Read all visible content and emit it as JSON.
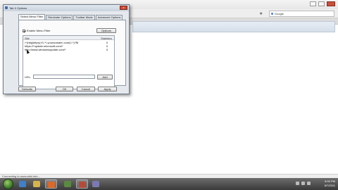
{
  "browser": {
    "search_engine": "Google",
    "status_text": "Connecting to www.abhi.info..."
  },
  "dialog": {
    "title": "Tab X Options",
    "close_label": "x",
    "tabs": [
      {
        "label": "Select Menu Filter"
      },
      {
        "label": "Reminder Options"
      },
      {
        "label": "Toolbar Mode"
      },
      {
        "label": "Advanced Options"
      }
    ],
    "checkbox_label": "Enable Menu Filter",
    "topright_button": "Options",
    "list": {
      "headers": {
        "site": "Site",
        "status": "Statistics"
      },
      "rows": [
        {
          "url": "/^(http|https):\\/\\/.*\\.yourdomain\\.com(\\/.*)?$/",
          "status": "0"
        },
        {
          "url": "https://*update.microsoft.com/*",
          "status": "0"
        },
        {
          "url": "http://www.windowsupdate.com/*",
          "status": "0"
        }
      ]
    },
    "url_label": "URL:",
    "url_value": "",
    "add_button": "Add",
    "footer_buttons": {
      "defaults": "Defaults",
      "ok": "OK",
      "cancel": "Cancel",
      "apply": "Apply"
    }
  },
  "taskbar": {
    "time": "5:00 PM",
    "date": "8/7/2011"
  }
}
